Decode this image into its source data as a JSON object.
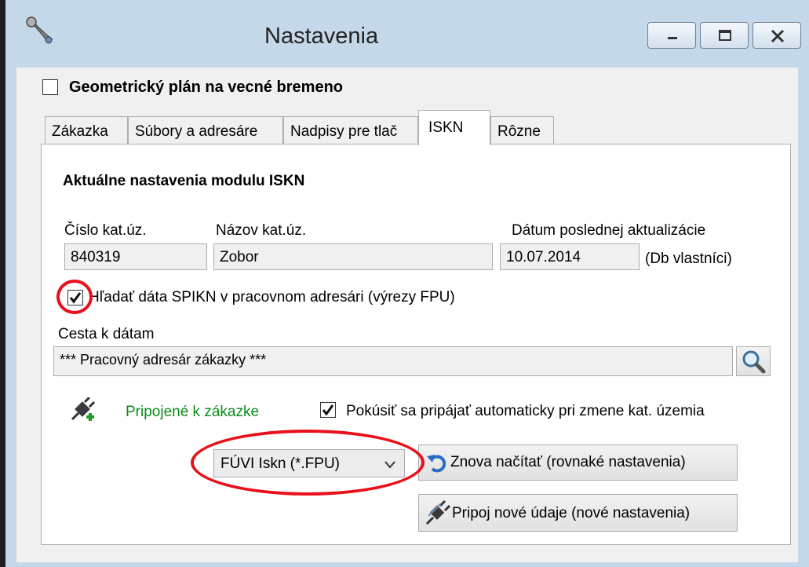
{
  "window": {
    "title": "Nastavenia",
    "icon": "wrench-icon",
    "controls": [
      "minimize-icon",
      "maximize-icon",
      "close-icon"
    ]
  },
  "top_checkbox": {
    "label": "Geometrický plán na vecné bremeno",
    "checked": false
  },
  "tabs": [
    {
      "label": "Zákazka",
      "active": false
    },
    {
      "label": "Súbory a adresáre",
      "active": false
    },
    {
      "label": "Nadpisy pre tlač",
      "active": false
    },
    {
      "label": "ISKN",
      "active": true
    },
    {
      "label": "Rôzne",
      "active": false
    }
  ],
  "iskn": {
    "heading": "Aktuálne nastavenia modulu ISKN",
    "cislo_label": "Číslo kat.úz.",
    "cislo_value": "840319",
    "nazov_label": "Názov kat.úz.",
    "nazov_value": "Zobor",
    "datum_label": "Dátum poslednej aktualizácie",
    "datum_value": "10.07.2014",
    "datum_note": "(Db vlastníci)",
    "search_checkbox_label": "Hľadať dáta SPIKN v pracovnom adresári (výrezy FPU)",
    "search_checkbox_checked": true,
    "path_label": "Cesta k dátam",
    "path_value": "*** Pracovný adresár zákazky ***",
    "browse_icon": "magnifier-icon",
    "status_icon": "plug-connected-icon",
    "status_text": "Pripojené k zákazke",
    "auto_checkbox_label": "Pokúsiť sa pripájať automaticky pri zmene kat. územia",
    "auto_checkbox_checked": true,
    "format_select_value": "FÚVI Iskn (*.FPU)",
    "reload_button": "Znova načítať (rovnaké nastavenia)",
    "reload_icon": "undo-arrow-icon",
    "connect_button": "Pripoj nové údaje (nové nastavenia)",
    "connect_icon": "plug-icon"
  },
  "colors": {
    "status_green": "#0a8a1a",
    "highlight_red": "#e8101a",
    "frame_blue": "#c5d8ea"
  }
}
